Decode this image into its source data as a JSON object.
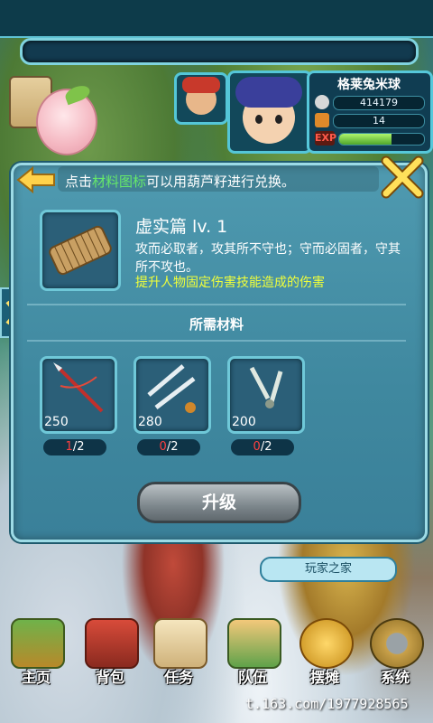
{
  "player": {
    "name": "格莱兔米球",
    "silver": "414179",
    "gold": "14",
    "exp_label": "EXP",
    "exp_fraction": 0.62
  },
  "dialog": {
    "hint_prefix": "点击",
    "hint_link": "材料图标",
    "hint_suffix": "可以用葫芦籽进行兑换。",
    "item_title": "虚实篇 lv. 1",
    "item_desc": "攻而必取者，攻其所不守也；守而必固者，守其所不攻也。",
    "item_effect": "提升人物固定伤害技能造成的伤害",
    "materials_title": "所需材料",
    "materials": [
      {
        "count": "250",
        "have": "1",
        "need": "/2"
      },
      {
        "count": "280",
        "have": "0",
        "need": "/2"
      },
      {
        "count": "200",
        "have": "0",
        "need": "/2"
      }
    ],
    "upgrade_label": "升级"
  },
  "home_tag": "玩家之家",
  "nav": [
    {
      "label": "主页",
      "icon": "house-icon"
    },
    {
      "label": "背包",
      "icon": "chest-icon"
    },
    {
      "label": "任务",
      "icon": "scroll-icon"
    },
    {
      "label": "队伍",
      "icon": "team-icon"
    },
    {
      "label": "摆摊",
      "icon": "coin-icon"
    },
    {
      "label": "系统",
      "icon": "gear-icon"
    }
  ],
  "watermark": "t.163.com/1977928565",
  "colors": {
    "highlight_green": "#66e86a",
    "effect_yellow": "#f0ff3a",
    "have_red": "#ff4040"
  }
}
